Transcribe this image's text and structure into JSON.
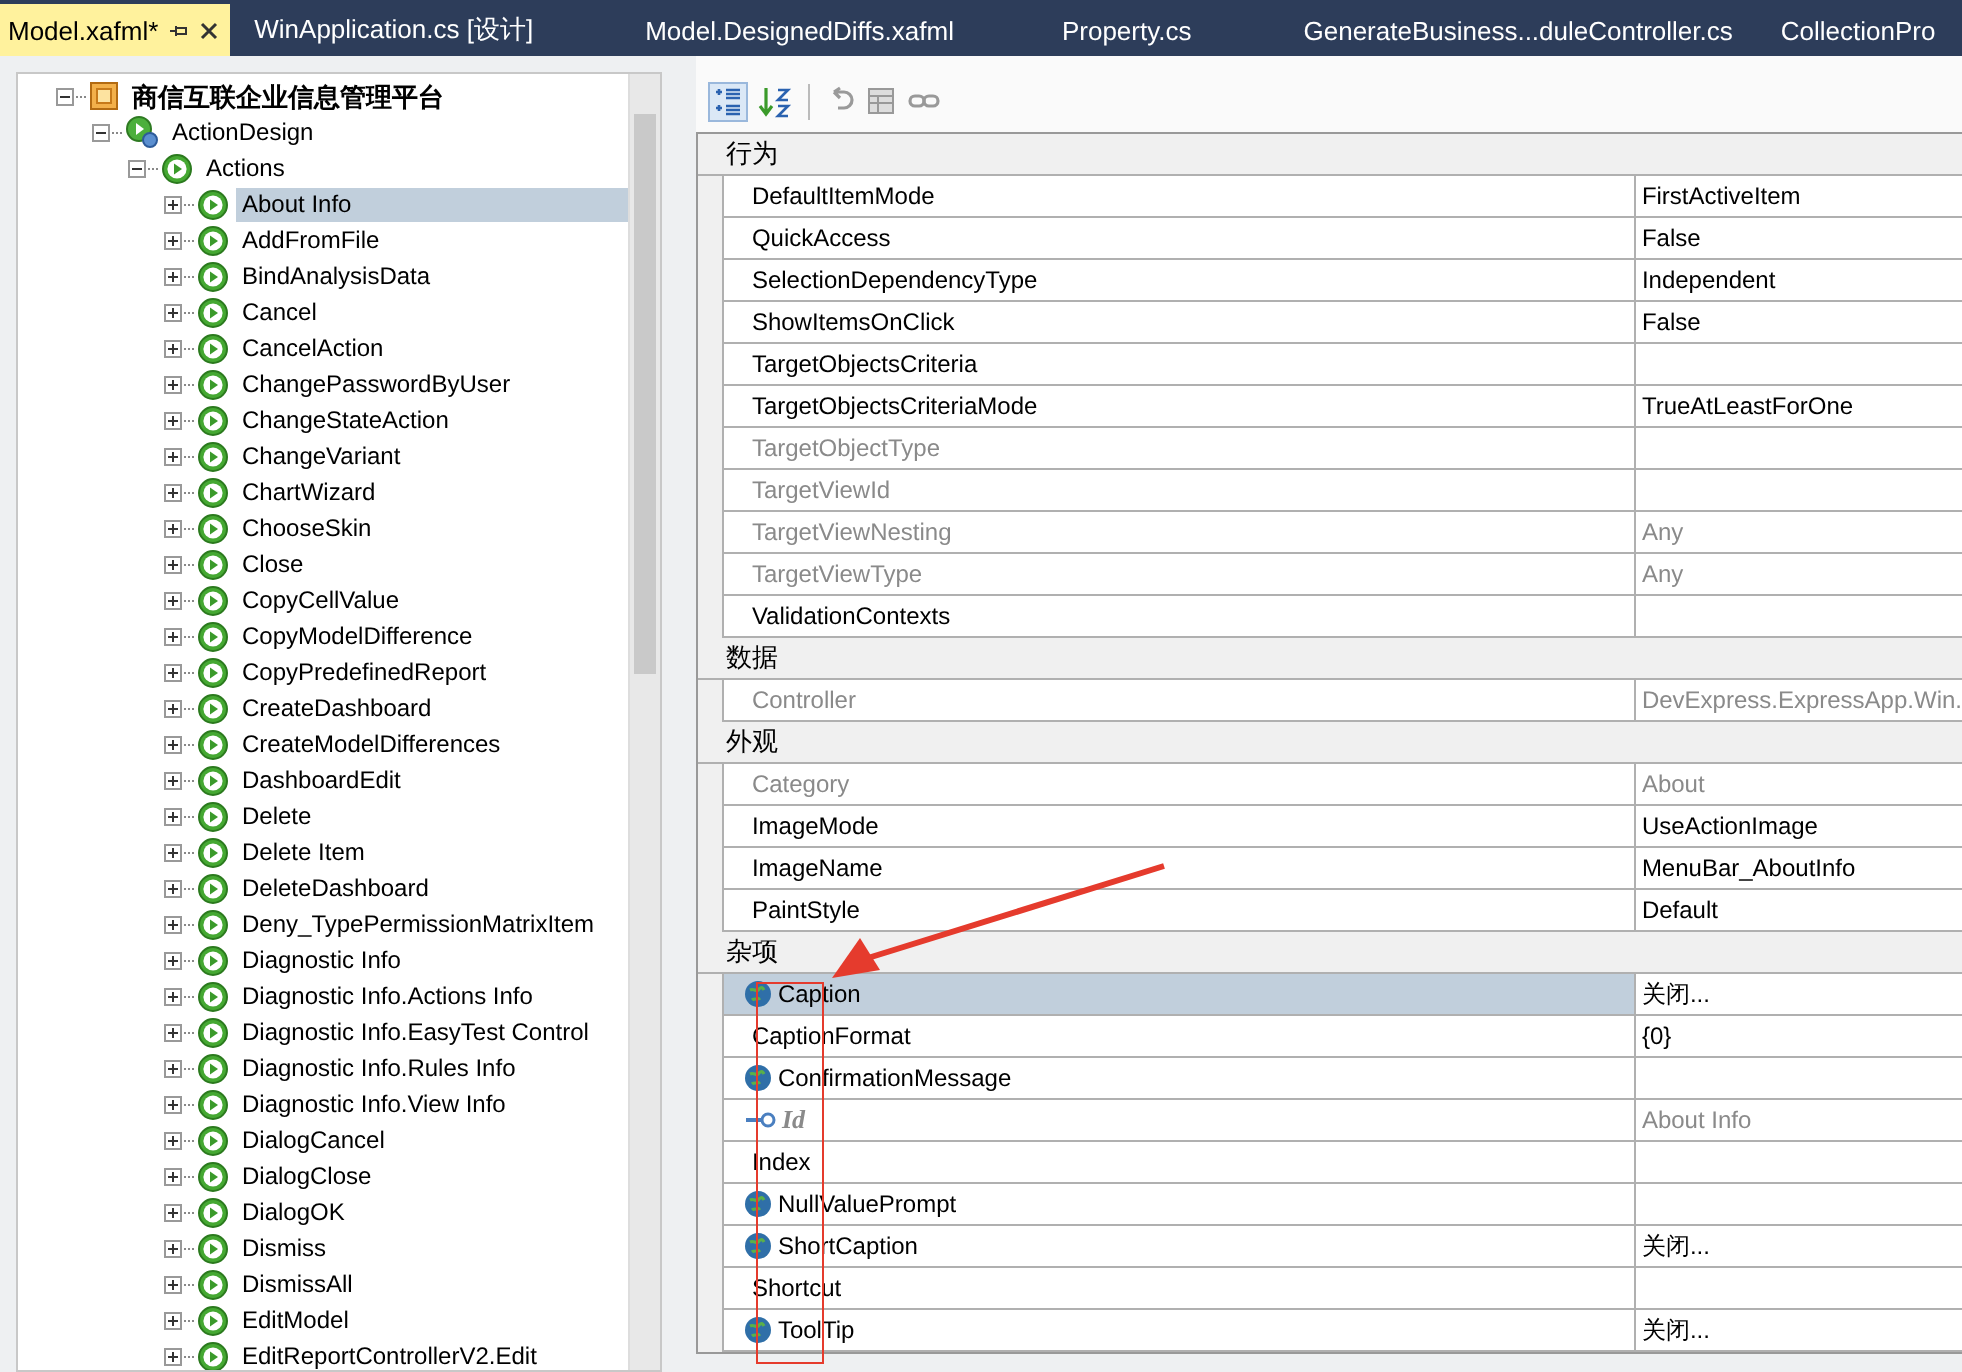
{
  "tabs": [
    {
      "label": "Model.xafml*",
      "selected": true
    },
    {
      "label": "WinApplication.cs [设计]",
      "selected": false
    },
    {
      "label": "Model.DesignedDiffs.xafml",
      "selected": false
    },
    {
      "label": "Property.cs",
      "selected": false
    },
    {
      "label": "GenerateBusiness...duleController.cs",
      "selected": false
    },
    {
      "label": "CollectionPro",
      "selected": false
    }
  ],
  "tree": {
    "label": "商信互联企业信息管理平台",
    "kind": "app",
    "expanded": true,
    "selected": false,
    "children": [
      {
        "label": "ActionDesign",
        "kind": "design",
        "expanded": true,
        "selected": false,
        "children": [
          {
            "label": "Actions",
            "kind": "action",
            "expanded": true,
            "selected": false,
            "children": [
              {
                "label": "About Info",
                "kind": "action",
                "expanded": false,
                "selected": true
              },
              {
                "label": "AddFromFile",
                "kind": "action",
                "expanded": false,
                "selected": false
              },
              {
                "label": "BindAnalysisData",
                "kind": "action",
                "expanded": false,
                "selected": false
              },
              {
                "label": "Cancel",
                "kind": "action",
                "expanded": false,
                "selected": false
              },
              {
                "label": "CancelAction",
                "kind": "action",
                "expanded": false,
                "selected": false
              },
              {
                "label": "ChangePasswordByUser",
                "kind": "action",
                "expanded": false,
                "selected": false
              },
              {
                "label": "ChangeStateAction",
                "kind": "action",
                "expanded": false,
                "selected": false
              },
              {
                "label": "ChangeVariant",
                "kind": "action",
                "expanded": false,
                "selected": false
              },
              {
                "label": "ChartWizard",
                "kind": "action",
                "expanded": false,
                "selected": false
              },
              {
                "label": "ChooseSkin",
                "kind": "action",
                "expanded": false,
                "selected": false
              },
              {
                "label": "Close",
                "kind": "action",
                "expanded": false,
                "selected": false
              },
              {
                "label": "CopyCellValue",
                "kind": "action",
                "expanded": false,
                "selected": false
              },
              {
                "label": "CopyModelDifference",
                "kind": "action",
                "expanded": false,
                "selected": false
              },
              {
                "label": "CopyPredefinedReport",
                "kind": "action",
                "expanded": false,
                "selected": false
              },
              {
                "label": "CreateDashboard",
                "kind": "action",
                "expanded": false,
                "selected": false
              },
              {
                "label": "CreateModelDifferences",
                "kind": "action",
                "expanded": false,
                "selected": false
              },
              {
                "label": "DashboardEdit",
                "kind": "action",
                "expanded": false,
                "selected": false
              },
              {
                "label": "Delete",
                "kind": "action",
                "expanded": false,
                "selected": false
              },
              {
                "label": "Delete Item",
                "kind": "action",
                "expanded": false,
                "selected": false
              },
              {
                "label": "DeleteDashboard",
                "kind": "action",
                "expanded": false,
                "selected": false
              },
              {
                "label": "Deny_TypePermissionMatrixItem",
                "kind": "action",
                "expanded": false,
                "selected": false
              },
              {
                "label": "Diagnostic Info",
                "kind": "action",
                "expanded": false,
                "selected": false
              },
              {
                "label": "Diagnostic Info.Actions Info",
                "kind": "action",
                "expanded": false,
                "selected": false
              },
              {
                "label": "Diagnostic Info.EasyTest Control",
                "kind": "action",
                "expanded": false,
                "selected": false
              },
              {
                "label": "Diagnostic Info.Rules Info",
                "kind": "action",
                "expanded": false,
                "selected": false
              },
              {
                "label": "Diagnostic Info.View Info",
                "kind": "action",
                "expanded": false,
                "selected": false
              },
              {
                "label": "DialogCancel",
                "kind": "action",
                "expanded": false,
                "selected": false
              },
              {
                "label": "DialogClose",
                "kind": "action",
                "expanded": false,
                "selected": false
              },
              {
                "label": "DialogOK",
                "kind": "action",
                "expanded": false,
                "selected": false
              },
              {
                "label": "Dismiss",
                "kind": "action",
                "expanded": false,
                "selected": false
              },
              {
                "label": "DismissAll",
                "kind": "action",
                "expanded": false,
                "selected": false
              },
              {
                "label": "EditModel",
                "kind": "action",
                "expanded": false,
                "selected": false
              },
              {
                "label": "EditReportControllerV2.Edit",
                "kind": "action",
                "expanded": false,
                "selected": false
              }
            ]
          }
        ]
      }
    ]
  },
  "properties": [
    {
      "category": "行为",
      "rows": [
        {
          "name": "DefaultItemMode",
          "value": "FirstActiveItem",
          "kind": "plain",
          "disabled": false,
          "selected": false
        },
        {
          "name": "QuickAccess",
          "value": "False",
          "kind": "plain",
          "disabled": false,
          "selected": false
        },
        {
          "name": "SelectionDependencyType",
          "value": "Independent",
          "kind": "plain",
          "disabled": false,
          "selected": false
        },
        {
          "name": "ShowItemsOnClick",
          "value": "False",
          "kind": "plain",
          "disabled": false,
          "selected": false
        },
        {
          "name": "TargetObjectsCriteria",
          "kind": "plain",
          "disabled": false,
          "selected": false
        },
        {
          "name": "TargetObjectsCriteriaMode",
          "value": "TrueAtLeastForOne",
          "kind": "plain",
          "disabled": false,
          "selected": false
        },
        {
          "name": "TargetObjectType",
          "kind": "plain",
          "disabled": true,
          "selected": false
        },
        {
          "name": "TargetViewId",
          "kind": "plain",
          "disabled": true,
          "selected": false
        },
        {
          "name": "TargetViewNesting",
          "value": "Any",
          "kind": "plain",
          "disabled": true,
          "selected": false
        },
        {
          "name": "TargetViewType",
          "value": "Any",
          "kind": "plain",
          "disabled": true,
          "selected": false
        },
        {
          "name": "ValidationContexts",
          "kind": "plain",
          "disabled": false,
          "selected": false
        }
      ]
    },
    {
      "category": "数据",
      "rows": [
        {
          "name": "Controller",
          "value": "DevExpress.ExpressApp.Win.",
          "kind": "plain",
          "disabled": true,
          "selected": false
        }
      ]
    },
    {
      "category": "外观",
      "rows": [
        {
          "name": "Category",
          "value": "About",
          "kind": "plain",
          "disabled": true,
          "selected": false
        },
        {
          "name": "ImageMode",
          "value": "UseActionImage",
          "kind": "plain",
          "disabled": false,
          "selected": false
        },
        {
          "name": "ImageName",
          "value": "MenuBar_AboutInfo",
          "kind": "plain",
          "disabled": false,
          "selected": false
        },
        {
          "name": "PaintStyle",
          "value": "Default",
          "kind": "plain",
          "disabled": false,
          "selected": false
        }
      ]
    },
    {
      "category": "杂项",
      "rows": [
        {
          "name": "Caption",
          "value": "关闭...",
          "kind": "localized",
          "disabled": false,
          "selected": true
        },
        {
          "name": "CaptionFormat",
          "value": "{0}",
          "kind": "plain",
          "disabled": false,
          "selected": false
        },
        {
          "name": "ConfirmationMessage",
          "kind": "localized",
          "disabled": false,
          "selected": false
        },
        {
          "name": "Id",
          "value": "About Info",
          "kind": "key",
          "disabled": true,
          "selected": false
        },
        {
          "name": "Index",
          "kind": "plain",
          "disabled": false,
          "selected": false
        },
        {
          "name": "NullValuePrompt",
          "kind": "localized",
          "disabled": false,
          "selected": false
        },
        {
          "name": "ShortCaption",
          "value": "关闭...",
          "kind": "localized",
          "disabled": false,
          "selected": false
        },
        {
          "name": "Shortcut",
          "kind": "plain",
          "disabled": false,
          "selected": false
        },
        {
          "name": "ToolTip",
          "value": "关闭...",
          "kind": "localized",
          "disabled": false,
          "selected": false
        }
      ]
    }
  ]
}
